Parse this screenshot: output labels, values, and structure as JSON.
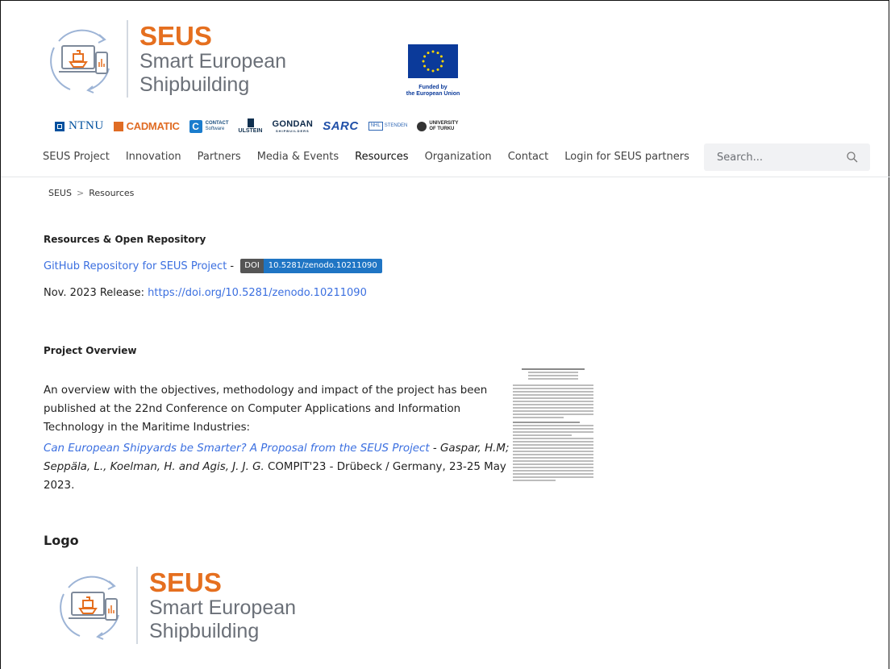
{
  "header": {
    "brand_name": "SEUS",
    "brand_sub_1": "Smart European",
    "brand_sub_2": "Shipbuilding",
    "eu_line_1": "Funded by",
    "eu_line_2": "the European Union",
    "partners": {
      "ntnu": "NTNU",
      "cadmatic": "CADMATIC",
      "contact_1": "CONTACT",
      "contact_2": "Software",
      "ulstein": "ULSTEIN",
      "gondan": "GONDAN",
      "gondan_sub": "SHIPBUILDERS",
      "sarc": "SARC",
      "nhl_1": "NHL",
      "nhl_2": "STENDEN",
      "utu_1": "UNIVERSITY",
      "utu_2": "OF TURKU"
    }
  },
  "nav": {
    "items": [
      {
        "label": "SEUS Project"
      },
      {
        "label": "Innovation"
      },
      {
        "label": "Partners"
      },
      {
        "label": "Media & Events"
      },
      {
        "label": "Resources"
      },
      {
        "label": "Organization"
      },
      {
        "label": "Contact"
      },
      {
        "label": "Login for SEUS partners"
      }
    ],
    "active": "Resources",
    "search_placeholder": "Search..."
  },
  "breadcrumb": {
    "home": "SEUS",
    "separator": ">",
    "current": "Resources"
  },
  "resources": {
    "heading": "Resources & Open Repository",
    "github_link": "GitHub Repository for SEUS Project",
    "dash": " - ",
    "doi_label": "DOI",
    "doi_value": "10.5281/zenodo.10211090",
    "release_label": "Nov. 2023 Release: ",
    "release_link": "https://doi.org/10.5281/zenodo.10211090"
  },
  "overview": {
    "heading": "Project Overview",
    "paragraph": "An overview with the objectives, methodology and impact of the project has been published at the 22nd Conference on Computer Applications and Information Technology in the Maritime Industries:",
    "paper_link": "Can European Shipyards be Smarter? A Proposal from the SEUS Project",
    "authors": " - Gaspar, H.M; Seppäla, L., Koelman, H. and Agis, J. J. G.",
    "venue": " COMPIT'23 - Drübeck / Germany, 23-25 May 2023."
  },
  "logo_section": {
    "heading": "Logo"
  },
  "colors": {
    "brand_orange": "#e56f1f",
    "link_blue": "#3b6fe0",
    "eu_blue": "#0b3a9a",
    "doi_blue": "#1f75c4"
  }
}
